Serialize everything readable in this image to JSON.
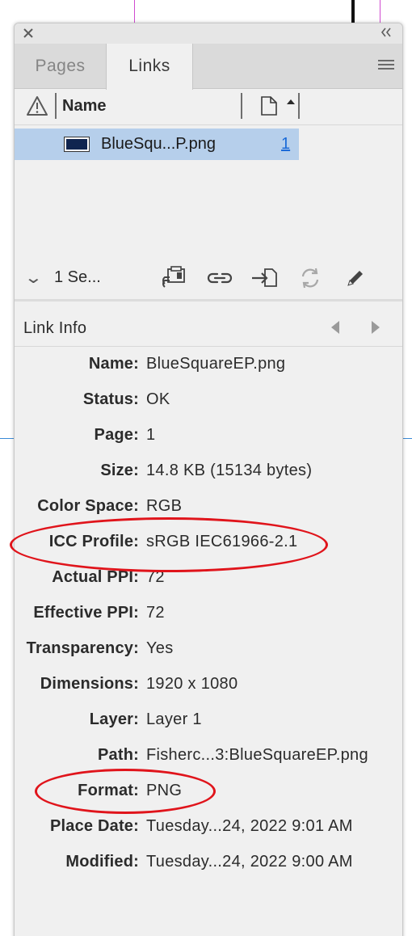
{
  "panel": {
    "tabs": [
      {
        "label": "Pages"
      },
      {
        "label": "Links"
      }
    ],
    "list_header": {
      "name_label": "Name"
    },
    "links": [
      {
        "name": "BlueSqu...P.png",
        "page": "1"
      }
    ],
    "toolbar": {
      "selected_label": "1 Se..."
    },
    "link_info": {
      "title": "Link Info",
      "rows": [
        {
          "label": "Name:",
          "value": "BlueSquareEP.png"
        },
        {
          "label": "Status:",
          "value": "OK"
        },
        {
          "label": "Page:",
          "value": "1"
        },
        {
          "label": "Size:",
          "value": "14.8 KB (15134 bytes)"
        },
        {
          "label": "Color Space:",
          "value": "RGB"
        },
        {
          "label": "ICC Profile:",
          "value": "sRGB IEC61966-2.1"
        },
        {
          "label": "Actual PPI:",
          "value": "72"
        },
        {
          "label": "Effective PPI:",
          "value": "72"
        },
        {
          "label": "Transparency:",
          "value": "Yes"
        },
        {
          "label": "Dimensions:",
          "value": "1920 x 1080"
        },
        {
          "label": "Layer:",
          "value": "Layer 1"
        },
        {
          "label": "Path:",
          "value": "Fisherc...3:BlueSquareEP.png"
        },
        {
          "label": "Format:",
          "value": "PNG"
        },
        {
          "label": "Place Date:",
          "value": "Tuesday...24, 2022 9:01 AM"
        },
        {
          "label": "Modified:",
          "value": "Tuesday...24, 2022 9:00 AM"
        }
      ]
    },
    "icons": [
      "close-icon",
      "collapse-panel-icon",
      "panel-menu-icon",
      "warning-icon",
      "page-icon",
      "sort-ascending-icon",
      "relink-to-folder-icon",
      "relink-icon",
      "go-to-link-icon",
      "update-link-icon",
      "edit-original-icon",
      "previous-icon",
      "next-icon"
    ],
    "colors": {
      "selection": "#b6cfeb",
      "annotation": "#e0141b",
      "link": "#1a6ad8"
    }
  }
}
